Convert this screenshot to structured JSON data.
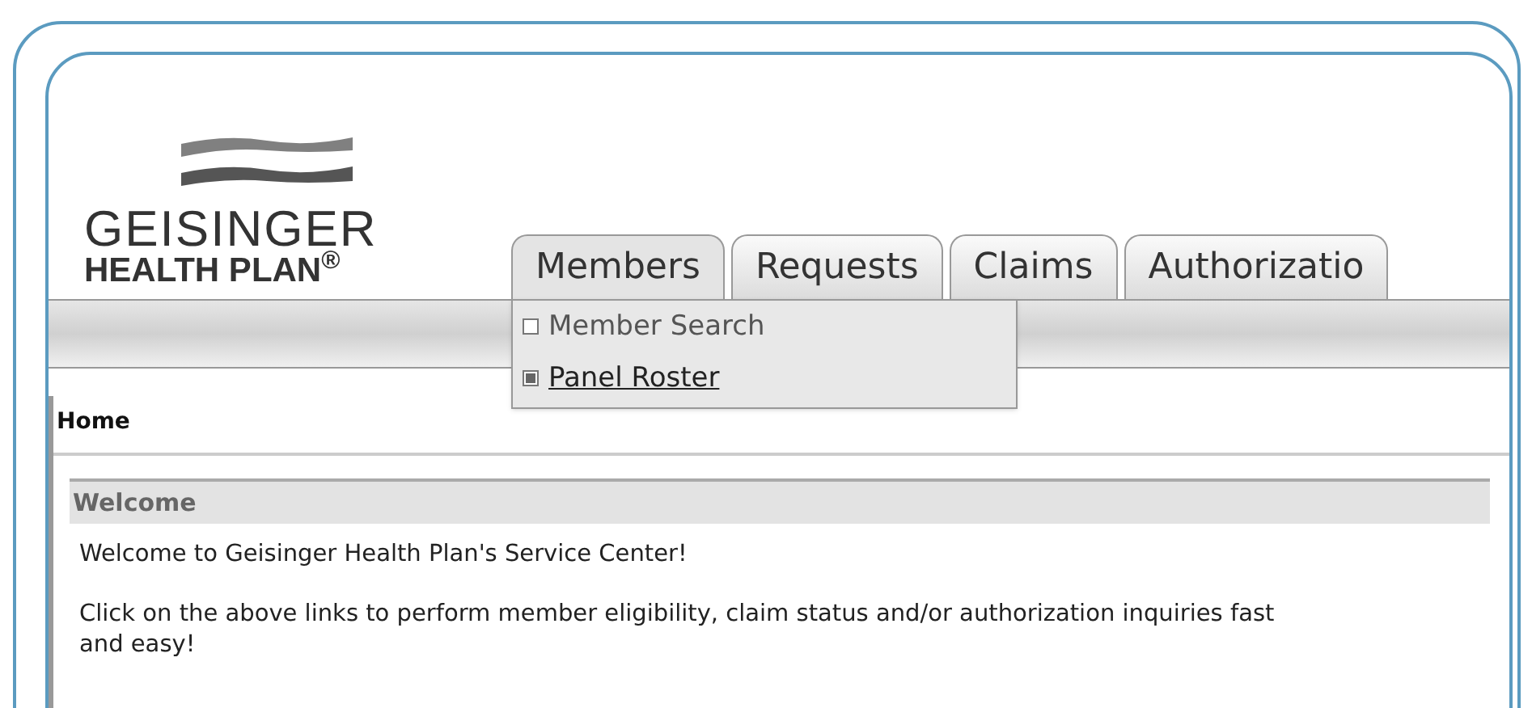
{
  "logo": {
    "line_1": "GEISINGER",
    "line_2": "HEALTH PLAN$^{®}$"
  },
  "tabs": [
    {
      "label": "Members",
      "selected": true
    },
    {
      "label": "Requests",
      "selected": false
    },
    {
      "label": "Claims",
      "selected": false
    },
    {
      "label": "Authorizatio",
      "selected": false
    }
  ],
  "menu": [
    {
      "label": "Member Search",
      "selected": false
    },
    {
      "label": "Panel Roster",
      "selected": true
    }
  ],
  "breadcrumb": "Home",
  "panel": {
    "title": "Welcome",
    "paragraphs": [
      "Welcome to Geisinger Health Plan's Service Center!",
      "Click on the above links to perform member eligibility, claim status and/or authorization inquiries fast and easy!"
    ]
  }
}
